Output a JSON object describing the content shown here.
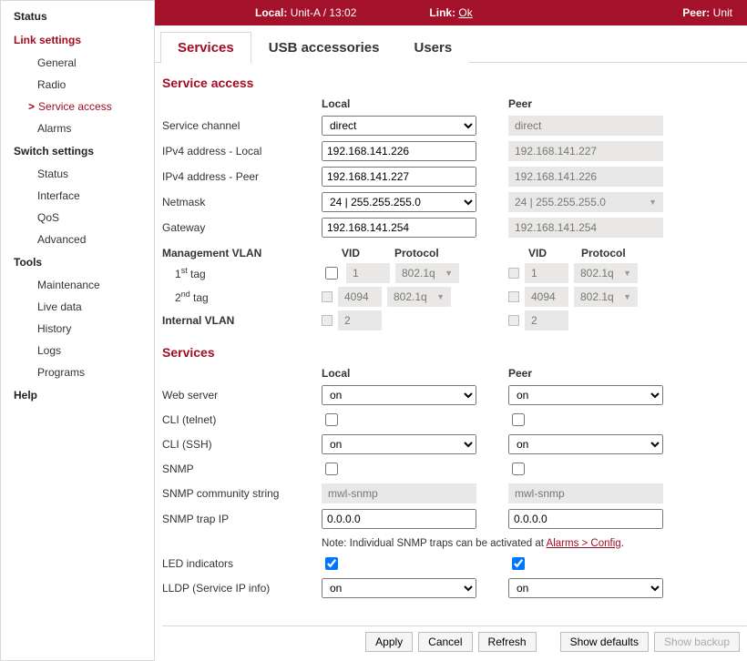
{
  "topbar": {
    "local_label": "Local:",
    "local_value": "Unit-A / 13:02",
    "link_label": "Link:",
    "link_value": "Ok",
    "peer_label": "Peer:",
    "peer_value": "Unit"
  },
  "sidebar": {
    "items": [
      {
        "label": "Status",
        "type": "top"
      },
      {
        "label": "Link settings",
        "type": "top",
        "active": true
      },
      {
        "label": "General",
        "type": "sub"
      },
      {
        "label": "Radio",
        "type": "sub"
      },
      {
        "label": "Service access",
        "type": "sub",
        "active": true
      },
      {
        "label": "Alarms",
        "type": "sub"
      },
      {
        "label": "Switch settings",
        "type": "top"
      },
      {
        "label": "Status",
        "type": "sub"
      },
      {
        "label": "Interface",
        "type": "sub"
      },
      {
        "label": "QoS",
        "type": "sub"
      },
      {
        "label": "Advanced",
        "type": "sub"
      },
      {
        "label": "Tools",
        "type": "top"
      },
      {
        "label": "Maintenance",
        "type": "sub"
      },
      {
        "label": "Live data",
        "type": "sub"
      },
      {
        "label": "History",
        "type": "sub"
      },
      {
        "label": "Logs",
        "type": "sub"
      },
      {
        "label": "Programs",
        "type": "sub"
      },
      {
        "label": "Help",
        "type": "top"
      }
    ]
  },
  "tabs": [
    {
      "label": "Services",
      "active": true
    },
    {
      "label": "USB accessories"
    },
    {
      "label": "Users"
    }
  ],
  "sections": {
    "service_access_title": "Service access",
    "services_title": "Services"
  },
  "columns": {
    "local": "Local",
    "peer": "Peer"
  },
  "rows": {
    "service_channel": {
      "label": "Service channel",
      "local": "direct",
      "peer": "direct"
    },
    "ipv4_local": {
      "label": "IPv4 address - Local",
      "local": "192.168.141.226",
      "peer": "192.168.141.227"
    },
    "ipv4_peer": {
      "label": "IPv4 address - Peer",
      "local": "192.168.141.227",
      "peer": "192.168.141.226"
    },
    "netmask": {
      "label": "Netmask",
      "local": "24  |  255.255.255.0",
      "peer": "24  |  255.255.255.0"
    },
    "gateway": {
      "label": "Gateway",
      "local": "192.168.141.254",
      "peer": "192.168.141.254"
    }
  },
  "vlan": {
    "title": "Management VLAN",
    "vid_label": "VID",
    "proto_label": "Protocol",
    "tag1_label": "1st tag",
    "tag2_label": "2nd tag",
    "internal_label": "Internal VLAN",
    "tag1": {
      "local": {
        "vid": "1",
        "proto": "802.1q"
      },
      "peer": {
        "vid": "1",
        "proto": "802.1q"
      }
    },
    "tag2": {
      "local": {
        "vid": "4094",
        "proto": "802.1q"
      },
      "peer": {
        "vid": "4094",
        "proto": "802.1q"
      }
    },
    "internal": {
      "local": "2",
      "peer": "2"
    }
  },
  "services": {
    "web": {
      "label": "Web server",
      "local": "on",
      "peer": "on"
    },
    "telnet": {
      "label": "CLI (telnet)"
    },
    "ssh": {
      "label": "CLI (SSH)",
      "local": "on",
      "peer": "on"
    },
    "snmp": {
      "label": "SNMP"
    },
    "comm": {
      "label": "SNMP community string",
      "local": "mwl-snmp",
      "peer": "mwl-snmp"
    },
    "trap": {
      "label": "SNMP trap IP",
      "local": "0.0.0.0",
      "peer": "0.0.0.0"
    },
    "note_prefix": "Note: Individual SNMP traps can be activated at ",
    "note_link": "Alarms > Config",
    "led": {
      "label": "LED indicators"
    },
    "lldp": {
      "label": "LLDP (Service IP info)",
      "local": "on",
      "peer": "on"
    }
  },
  "buttons": {
    "apply": "Apply",
    "cancel": "Cancel",
    "refresh": "Refresh",
    "defaults": "Show defaults",
    "backup": "Show backup"
  }
}
